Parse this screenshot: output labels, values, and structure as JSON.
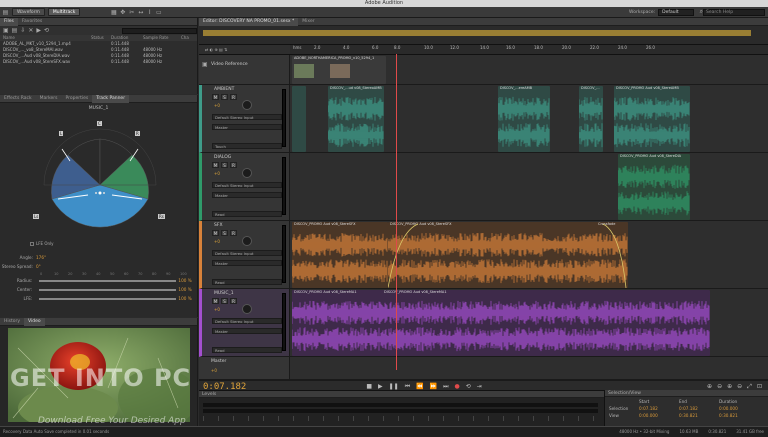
{
  "window": {
    "title": "Adobe Audition"
  },
  "toolbar": {
    "waveform_label": "Waveform",
    "multitrack_label": "Multitrack",
    "workspace_label": "Workspace:",
    "workspace_value": "Default",
    "search_placeholder": "Search Help"
  },
  "files": {
    "tab_files": "Files",
    "tab_favorites": "Favorites",
    "columns": [
      "Name",
      "Status",
      "Duration",
      "Sample Rate",
      "Cha"
    ],
    "rows": [
      {
        "name": "ADOBE_AL_MKT_v10_5294_1.mp4",
        "duration": "0:11.448",
        "rate": ""
      },
      {
        "name": "DISCOV_..._vo8_StereMAI.wav",
        "duration": "0:11.448",
        "rate": "48000 Hz"
      },
      {
        "name": "DISCOV_...Aud v08_StereDIA.wav",
        "duration": "0:11.448",
        "rate": "48000 Hz"
      },
      {
        "name": "DISCOV_...Aud v08_StereSFX.wav",
        "duration": "0:11.448",
        "rate": "48000 Hz"
      }
    ]
  },
  "panel": {
    "tabs": [
      "Effects Rack",
      "Markers",
      "Properties",
      "Track Panner"
    ],
    "track": "MUSIC_1",
    "speaker_labels": [
      "L",
      "C",
      "R",
      "Ls",
      "Rs"
    ],
    "lfe_only": "LFE Only",
    "params": [
      {
        "k": "Angle:",
        "v": "176°"
      },
      {
        "k": "Stereo Spread:",
        "v": "0°"
      },
      {
        "k": "Radius:",
        "v": "100 %"
      },
      {
        "k": "Center:",
        "v": "100 %"
      },
      {
        "k": "LFE:",
        "v": "100 %"
      }
    ],
    "scale": [
      "0",
      "10",
      "20",
      "30",
      "40",
      "50",
      "60",
      "70",
      "80",
      "90",
      "100"
    ]
  },
  "history": {
    "tab_history": "History",
    "tab_video": "Video"
  },
  "editor": {
    "tab": "Editor: DISCOVERY NA PROMO_01.sesx *",
    "mixer_tab": "Mixer",
    "ruler": [
      "hms",
      "2.0",
      "4.0",
      "6.0",
      "8.0",
      "10.0",
      "12.0",
      "14.0",
      "16.0",
      "18.0",
      "20.0",
      "22.0",
      "24.0",
      "26.0"
    ],
    "tracks": [
      {
        "name": "Video Reference",
        "clip": "ADOBE_NORTHAMERICA_PROMO_v10_5294_1"
      },
      {
        "name": "AMBIENT",
        "vol": "+0",
        "input": "Default Stereo Input",
        "output": "Master",
        "mode": "Touch"
      },
      {
        "name": "DIALOG",
        "vol": "+0",
        "input": "Default Stereo Input",
        "output": "Master",
        "mode": "Read"
      },
      {
        "name": "SFX",
        "vol": "+0",
        "input": "Default Stereo Input",
        "output": "Master",
        "mode": "Read"
      },
      {
        "name": "MUSIC_1",
        "vol": "+0",
        "input": "Default Stereo Input",
        "output": "Master",
        "mode": "Read"
      },
      {
        "name": "Master",
        "vol": "+0"
      }
    ],
    "clip_labels": {
      "amb1": "DISCOV_...ud v08_StereoAMB",
      "amb2": "DISCOV_...ereAMB",
      "amb3": "DISCOV_...",
      "amb4": "DISCOV_PROMO Aud v08_StereAMB",
      "dia": "DISCOV_PROMO Aud v08_StereDIA",
      "sfx1": "DISCOV_PROMO Aud v08_StereSFX",
      "sfx2": "DISCOV_PROMO Aud v08_StereSFX",
      "crossfade": "Crossfade",
      "music1": "DISCOV_PROMO Aud v08_StereMA1",
      "music2": "DISCOV_PROMO Aud v08_StereMA1"
    },
    "timecode": "0:07.182"
  },
  "levels": {
    "title": "Levels"
  },
  "selection": {
    "title": "Selection/View",
    "headers": [
      "Start",
      "End",
      "Duration"
    ],
    "selection_label": "Selection",
    "view_label": "View",
    "selection": [
      "0:07.182",
      "0:07.182",
      "0:00.000"
    ],
    "view": [
      "0:00.000",
      "0:30.821",
      "0:30.821"
    ]
  },
  "status": {
    "left": "Recovery Data Auto Save completed in 0.01 seconds",
    "right": [
      "48000 Hz • 32-bit Mixing",
      "10.63 MB",
      "0:30.821",
      "31.41 GB free"
    ]
  },
  "watermark": {
    "line1": "GET INTO PC",
    "line2": "Download Free Your Desired App"
  },
  "colors": {
    "ambient": "#3f9c8a",
    "dialog": "#2f9b6a",
    "sfx": "#d8823a",
    "music": "#a44fd0",
    "playhead": "#e04a4a"
  }
}
